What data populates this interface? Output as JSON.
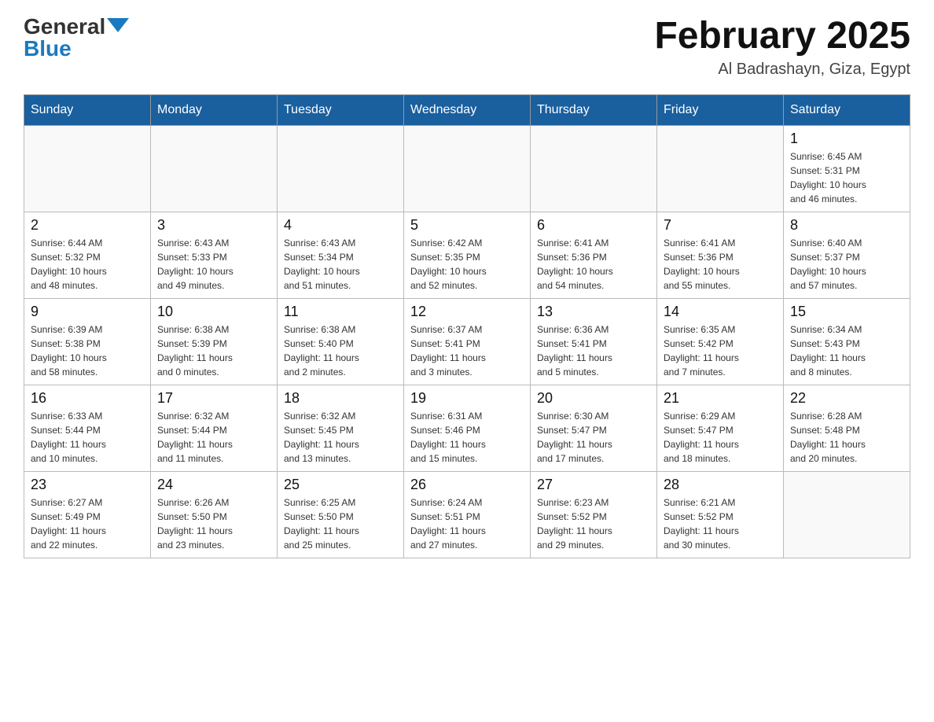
{
  "header": {
    "logo_general": "General",
    "logo_blue": "Blue",
    "month_title": "February 2025",
    "location": "Al Badrashayn, Giza, Egypt"
  },
  "weekdays": [
    "Sunday",
    "Monday",
    "Tuesday",
    "Wednesday",
    "Thursday",
    "Friday",
    "Saturday"
  ],
  "weeks": [
    [
      {
        "day": "",
        "info": ""
      },
      {
        "day": "",
        "info": ""
      },
      {
        "day": "",
        "info": ""
      },
      {
        "day": "",
        "info": ""
      },
      {
        "day": "",
        "info": ""
      },
      {
        "day": "",
        "info": ""
      },
      {
        "day": "1",
        "info": "Sunrise: 6:45 AM\nSunset: 5:31 PM\nDaylight: 10 hours\nand 46 minutes."
      }
    ],
    [
      {
        "day": "2",
        "info": "Sunrise: 6:44 AM\nSunset: 5:32 PM\nDaylight: 10 hours\nand 48 minutes."
      },
      {
        "day": "3",
        "info": "Sunrise: 6:43 AM\nSunset: 5:33 PM\nDaylight: 10 hours\nand 49 minutes."
      },
      {
        "day": "4",
        "info": "Sunrise: 6:43 AM\nSunset: 5:34 PM\nDaylight: 10 hours\nand 51 minutes."
      },
      {
        "day": "5",
        "info": "Sunrise: 6:42 AM\nSunset: 5:35 PM\nDaylight: 10 hours\nand 52 minutes."
      },
      {
        "day": "6",
        "info": "Sunrise: 6:41 AM\nSunset: 5:36 PM\nDaylight: 10 hours\nand 54 minutes."
      },
      {
        "day": "7",
        "info": "Sunrise: 6:41 AM\nSunset: 5:36 PM\nDaylight: 10 hours\nand 55 minutes."
      },
      {
        "day": "8",
        "info": "Sunrise: 6:40 AM\nSunset: 5:37 PM\nDaylight: 10 hours\nand 57 minutes."
      }
    ],
    [
      {
        "day": "9",
        "info": "Sunrise: 6:39 AM\nSunset: 5:38 PM\nDaylight: 10 hours\nand 58 minutes."
      },
      {
        "day": "10",
        "info": "Sunrise: 6:38 AM\nSunset: 5:39 PM\nDaylight: 11 hours\nand 0 minutes."
      },
      {
        "day": "11",
        "info": "Sunrise: 6:38 AM\nSunset: 5:40 PM\nDaylight: 11 hours\nand 2 minutes."
      },
      {
        "day": "12",
        "info": "Sunrise: 6:37 AM\nSunset: 5:41 PM\nDaylight: 11 hours\nand 3 minutes."
      },
      {
        "day": "13",
        "info": "Sunrise: 6:36 AM\nSunset: 5:41 PM\nDaylight: 11 hours\nand 5 minutes."
      },
      {
        "day": "14",
        "info": "Sunrise: 6:35 AM\nSunset: 5:42 PM\nDaylight: 11 hours\nand 7 minutes."
      },
      {
        "day": "15",
        "info": "Sunrise: 6:34 AM\nSunset: 5:43 PM\nDaylight: 11 hours\nand 8 minutes."
      }
    ],
    [
      {
        "day": "16",
        "info": "Sunrise: 6:33 AM\nSunset: 5:44 PM\nDaylight: 11 hours\nand 10 minutes."
      },
      {
        "day": "17",
        "info": "Sunrise: 6:32 AM\nSunset: 5:44 PM\nDaylight: 11 hours\nand 11 minutes."
      },
      {
        "day": "18",
        "info": "Sunrise: 6:32 AM\nSunset: 5:45 PM\nDaylight: 11 hours\nand 13 minutes."
      },
      {
        "day": "19",
        "info": "Sunrise: 6:31 AM\nSunset: 5:46 PM\nDaylight: 11 hours\nand 15 minutes."
      },
      {
        "day": "20",
        "info": "Sunrise: 6:30 AM\nSunset: 5:47 PM\nDaylight: 11 hours\nand 17 minutes."
      },
      {
        "day": "21",
        "info": "Sunrise: 6:29 AM\nSunset: 5:47 PM\nDaylight: 11 hours\nand 18 minutes."
      },
      {
        "day": "22",
        "info": "Sunrise: 6:28 AM\nSunset: 5:48 PM\nDaylight: 11 hours\nand 20 minutes."
      }
    ],
    [
      {
        "day": "23",
        "info": "Sunrise: 6:27 AM\nSunset: 5:49 PM\nDaylight: 11 hours\nand 22 minutes."
      },
      {
        "day": "24",
        "info": "Sunrise: 6:26 AM\nSunset: 5:50 PM\nDaylight: 11 hours\nand 23 minutes."
      },
      {
        "day": "25",
        "info": "Sunrise: 6:25 AM\nSunset: 5:50 PM\nDaylight: 11 hours\nand 25 minutes."
      },
      {
        "day": "26",
        "info": "Sunrise: 6:24 AM\nSunset: 5:51 PM\nDaylight: 11 hours\nand 27 minutes."
      },
      {
        "day": "27",
        "info": "Sunrise: 6:23 AM\nSunset: 5:52 PM\nDaylight: 11 hours\nand 29 minutes."
      },
      {
        "day": "28",
        "info": "Sunrise: 6:21 AM\nSunset: 5:52 PM\nDaylight: 11 hours\nand 30 minutes."
      },
      {
        "day": "",
        "info": ""
      }
    ]
  ]
}
